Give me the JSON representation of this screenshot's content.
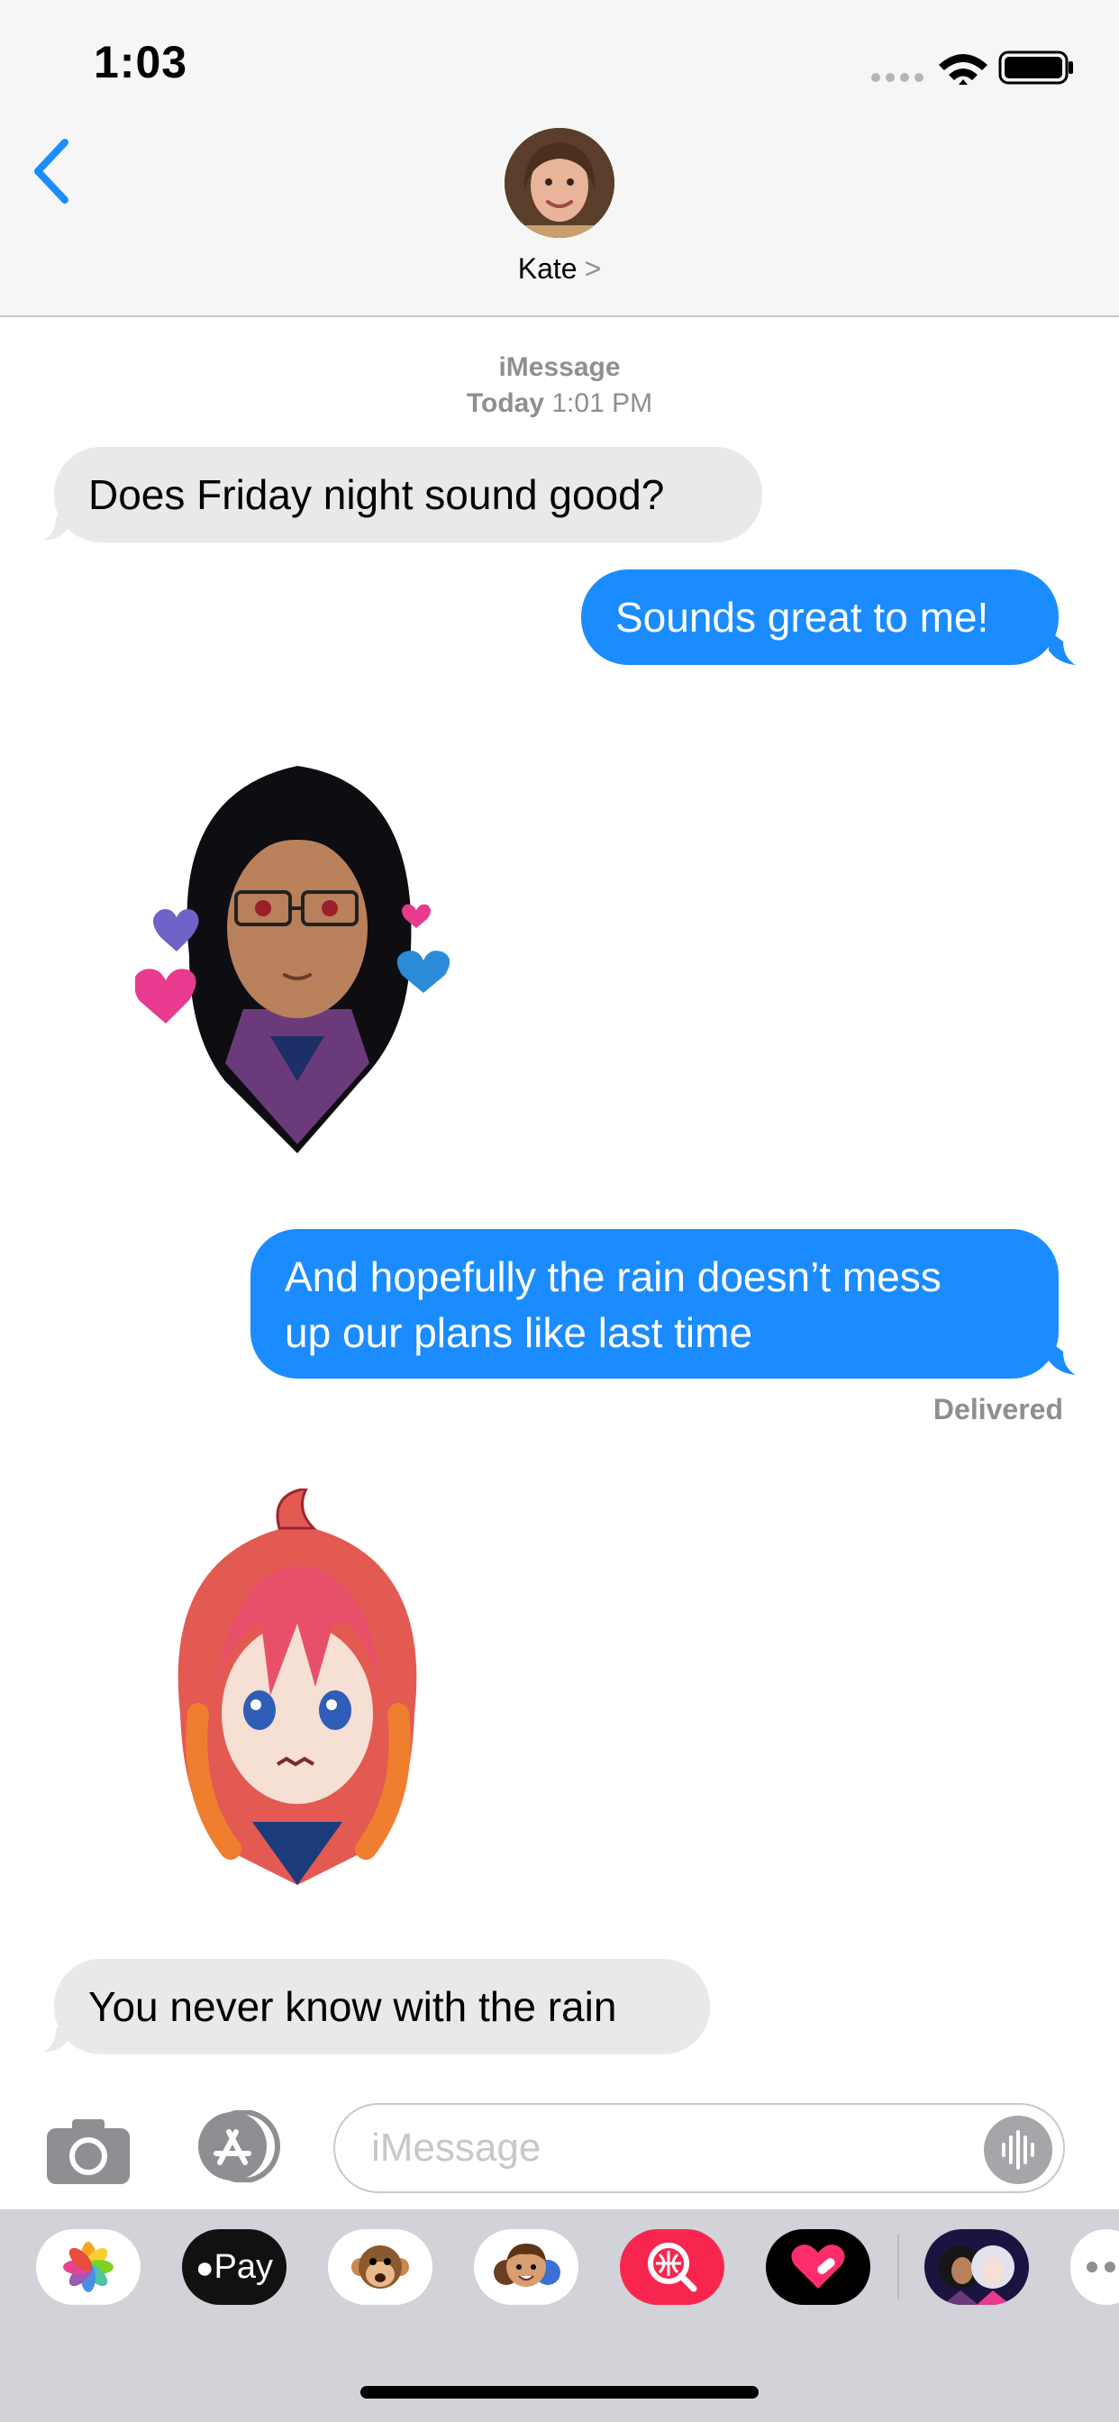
{
  "status": {
    "time": "1:03"
  },
  "header": {
    "contact_name": "Kate",
    "chevron": ">"
  },
  "thread": {
    "service": "iMessage",
    "day": "Today",
    "time": "1:01 PM",
    "messages": [
      {
        "direction": "incoming",
        "text": "Does Friday night sound good?"
      },
      {
        "direction": "outgoing",
        "text": "Sounds great to me!"
      },
      {
        "direction": "incoming",
        "type": "sticker",
        "icon": "anime-girl-glasses-hearts-sticker"
      },
      {
        "direction": "outgoing",
        "text_line1": "And hopefully the rain doesn’t mess",
        "text_line2": "up our plans like last time"
      },
      {
        "direction": "incoming",
        "type": "sticker",
        "icon": "anime-girl-red-hair-sticker"
      },
      {
        "direction": "incoming",
        "text": "You never know with the rain"
      }
    ],
    "delivery_status": "Delivered"
  },
  "composer": {
    "placeholder": "iMessage"
  },
  "app_drawer": {
    "items": [
      {
        "name": "photos-app-icon"
      },
      {
        "name": "apple-pay-icon",
        "label": "Pay"
      },
      {
        "name": "animoji-monkey-icon"
      },
      {
        "name": "memoji-icon"
      },
      {
        "name": "image-search-icon"
      },
      {
        "name": "digital-touch-icon"
      },
      {
        "name": "sticker-pack-icon"
      },
      {
        "name": "more-apps-icon"
      }
    ]
  },
  "colors": {
    "accent": "#1a8cff",
    "incoming_bubble": "#e9e9eb",
    "header_bg": "#f6f6f6",
    "drawer_bg": "#d1d3d9"
  }
}
